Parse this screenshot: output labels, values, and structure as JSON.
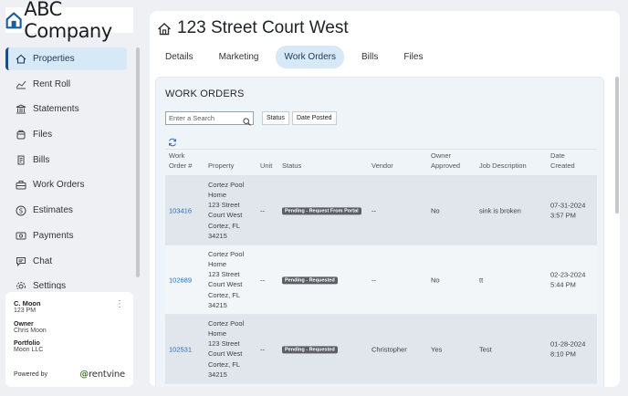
{
  "logo": {
    "text": "ABC Company"
  },
  "nav": {
    "items": [
      {
        "label": "Properties",
        "icon": "home-icon",
        "active": true
      },
      {
        "label": "Rent Roll",
        "icon": "chart-icon"
      },
      {
        "label": "Statements",
        "icon": "bank-icon"
      },
      {
        "label": "Files",
        "icon": "folder-icon"
      },
      {
        "label": "Bills",
        "icon": "receipt-icon"
      },
      {
        "label": "Work Orders",
        "icon": "toolbox-icon"
      },
      {
        "label": "Estimates",
        "icon": "dollar-icon"
      },
      {
        "label": "Payments",
        "icon": "payment-icon"
      },
      {
        "label": "Chat",
        "icon": "chat-icon"
      },
      {
        "label": "Settings",
        "icon": "gear-icon"
      }
    ]
  },
  "account": {
    "name": "C. Moon",
    "unit": "123 PM",
    "owner_label": "Owner",
    "owner_value": "Chris Moon",
    "portfolio_label": "Portfolio",
    "portfolio_value": "Moon LLC",
    "powered_by": "Powered by",
    "brand_mark": "@",
    "brand": "rentvine"
  },
  "page": {
    "title": "123 Street Court West",
    "tabs": [
      "Details",
      "Marketing",
      "Work Orders",
      "Bills",
      "Files"
    ],
    "active_tab": "Work Orders"
  },
  "work_orders": {
    "title": "WORK ORDERS",
    "search_placeholder": "Enter a Search",
    "filters": [
      "Status",
      "Date Posted"
    ],
    "columns": {
      "wo_line1": "Work",
      "wo_line2": "Order #",
      "property": "Property",
      "unit": "Unit",
      "status": "Status",
      "vendor": "Vendor",
      "owner_line1": "Owner",
      "owner_line2": "Approved",
      "job": "Job Description",
      "date_line1": "Date",
      "date_line2": "Created"
    },
    "rows": [
      {
        "number": "103416",
        "property": [
          "Cortez Pool",
          "Home",
          "123 Street",
          "Court West",
          "Cortez, FL",
          "34215"
        ],
        "unit": "--",
        "status": "Pending - Request From Portal",
        "vendor": "--",
        "owner_approved": "No",
        "job": "sink is broken",
        "date": "07-31-2024",
        "time": "3:57 PM"
      },
      {
        "number": "102689",
        "property": [
          "Cortez Pool",
          "Home",
          "123 Street",
          "Court West",
          "Cortez, FL",
          "34215"
        ],
        "unit": "--",
        "status": "Pending - Requested",
        "vendor": "--",
        "owner_approved": "No",
        "job": "tt",
        "date": "02-23-2024",
        "time": "5:44 PM"
      },
      {
        "number": "102531",
        "property": [
          "Cortez Pool",
          "Home",
          "123 Street",
          "Court West",
          "Cortez, FL",
          "34215"
        ],
        "unit": "--",
        "status": "Pending - Requested",
        "vendor": "Christopher",
        "owner_approved": "Yes",
        "job": "Test",
        "date": "01-28-2024",
        "time": "8:10 PM"
      }
    ]
  },
  "colors": {
    "accent": "#1b4d7e",
    "active_bg": "#d7e8f6",
    "link": "#2a6db0",
    "badge": "#5b5f65"
  }
}
